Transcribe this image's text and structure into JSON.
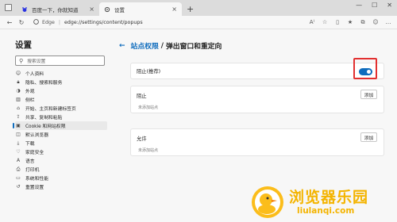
{
  "tabs": [
    {
      "label": "百度一下，你就知道",
      "icon": "baidu-icon"
    },
    {
      "label": "设置",
      "icon": "gear-icon"
    }
  ],
  "address": {
    "browser_label": "Edge",
    "separator": "|",
    "url": "edge://settings/content/popups"
  },
  "sidebar": {
    "title": "设置",
    "search_placeholder": "搜索设置",
    "items": [
      {
        "label": "个人资料",
        "icon": "profile-icon"
      },
      {
        "label": "隐私、搜索和服务",
        "icon": "lock-icon"
      },
      {
        "label": "外观",
        "icon": "appearance-icon"
      },
      {
        "label": "侧栏",
        "icon": "sidebar-icon"
      },
      {
        "label": "开始、主页和新建标签页",
        "icon": "home-icon"
      },
      {
        "label": "共享、复制和粘贴",
        "icon": "share-icon"
      },
      {
        "label": "Cookie 和网站权限",
        "icon": "site-permissions-icon",
        "active": true
      },
      {
        "label": "默认浏览器",
        "icon": "browser-icon"
      },
      {
        "label": "下载",
        "icon": "download-icon"
      },
      {
        "label": "家庭安全",
        "icon": "family-icon"
      },
      {
        "label": "语言",
        "icon": "language-icon"
      },
      {
        "label": "打印机",
        "icon": "printer-icon"
      },
      {
        "label": "系统和性能",
        "icon": "system-icon"
      },
      {
        "label": "重置设置",
        "icon": "reset-icon"
      }
    ]
  },
  "main": {
    "breadcrumb_parent": "站点权限",
    "breadcrumb_sep": "/",
    "page_title": "弹出窗口和重定向",
    "block_setting": {
      "label": "阻止(推荐)",
      "enabled": true
    },
    "block_list": {
      "title": "阻止",
      "add_label": "添加",
      "empty_text": "未添加站点"
    },
    "allow_list": {
      "title": "允许",
      "add_label": "添加",
      "empty_text": "未添加站点"
    }
  },
  "watermark": {
    "cn": "浏览器乐园",
    "en": "liulanqi.com"
  },
  "colors": {
    "accent": "#0f6cbd",
    "highlight": "#e23030",
    "watermark": "#f4b400"
  }
}
